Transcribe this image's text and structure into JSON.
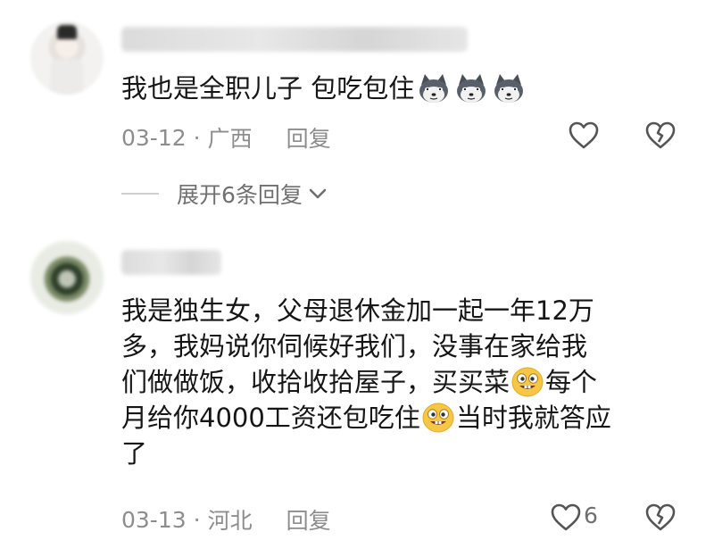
{
  "comments": [
    {
      "text_lines": [
        "我也是全职儿子 包吃包住"
      ],
      "emojis": [
        "husky-dog-emoji",
        "husky-dog-emoji",
        "husky-dog-emoji"
      ],
      "date": "03-12",
      "location": "广西",
      "reply_label": "回复",
      "expand_label": "展开6条回复",
      "like_count": ""
    },
    {
      "line1": "我是独生女，父母退休金加一起一年12万",
      "line2": "多，我妈说你伺候好我们，没事在家给我",
      "line3": "们做做饭，收拾收拾屋子，买买菜",
      "line3_tail": "每个",
      "line4": "月给你4000工资还包吃住",
      "line4_tail": "当时我就答应",
      "line5": "了",
      "emojis": [
        "grinning-face-emoji",
        "grinning-face-emoji"
      ],
      "date": "03-13",
      "location": "河北",
      "reply_label": "回复",
      "like_count": "6"
    }
  ],
  "colors": {
    "text": "#161616",
    "meta": "#8d8d8d",
    "icon": "#555555"
  }
}
